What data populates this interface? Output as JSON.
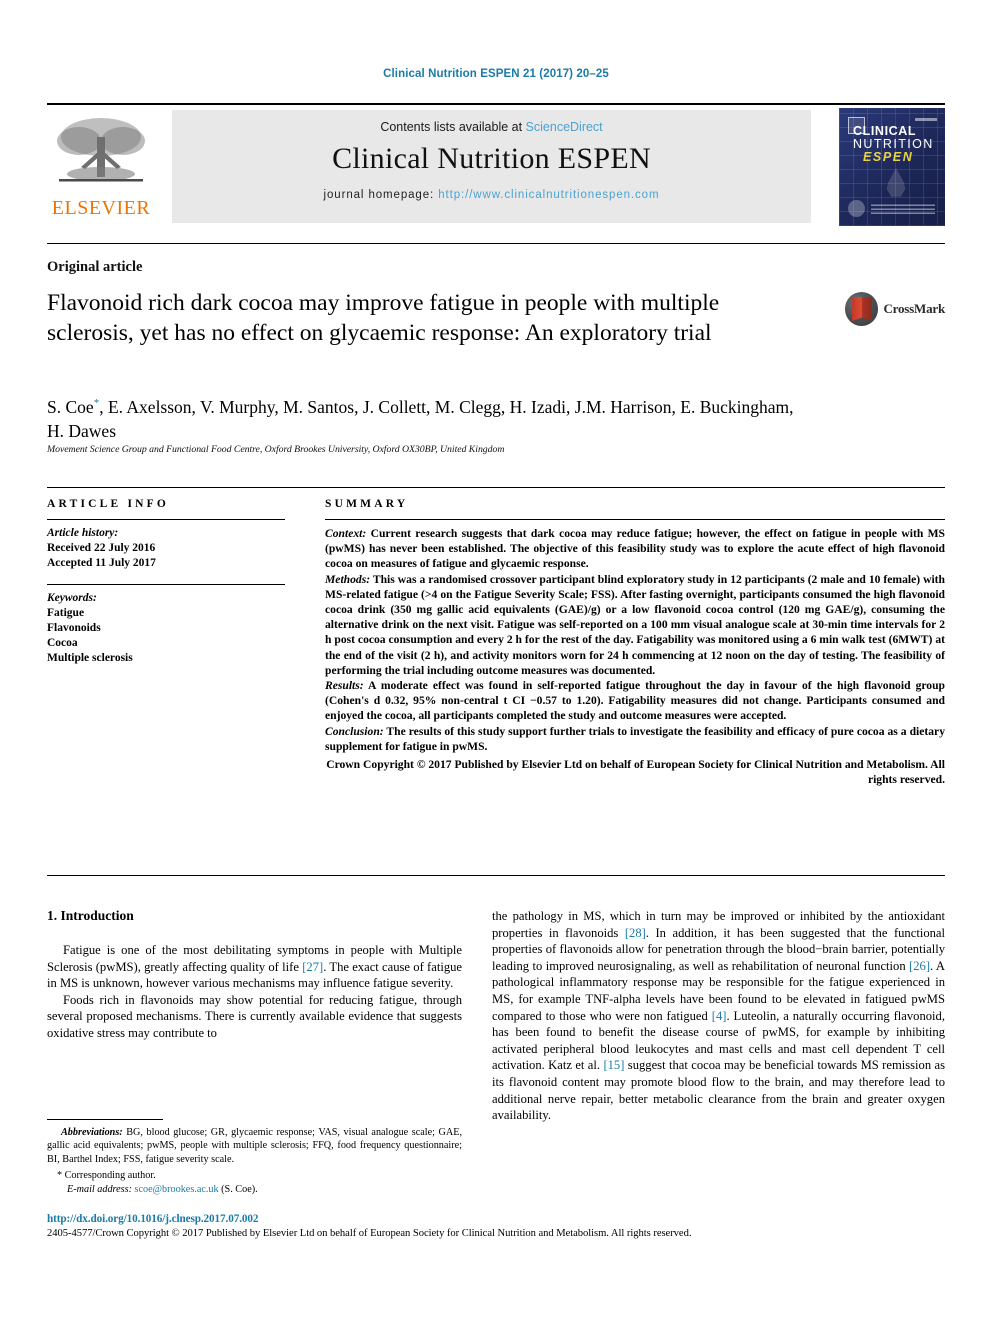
{
  "running_head": "Clinical Nutrition ESPEN 21 (2017) 20–25",
  "masthead": {
    "contents_prefix": "Contents lists available at ",
    "sciencedirect": "ScienceDirect",
    "journal_name": "Clinical Nutrition ESPEN",
    "homepage_label": "journal homepage:",
    "homepage_url": "http://www.clinicalnutritionespen.com",
    "publisher_logo_text": "ELSEVIER",
    "cover": {
      "line1": "CLINICAL",
      "line2": "NUTRITION",
      "line3": "ESPEN"
    },
    "accent_blue": "#4aa3d1",
    "elsevier_orange": "#ec7404"
  },
  "article": {
    "type": "Original article",
    "title": "Flavonoid rich dark cocoa may improve fatigue in people with multiple sclerosis, yet has no effect on glycaemic response: An exploratory trial",
    "authors": "S. Coe",
    "authors_rest": ", E. Axelsson, V. Murphy, M. Santos, J. Collett, M. Clegg, H. Izadi, J.M. Harrison, E. Buckingham, H. Dawes",
    "corresponding_marker": "*",
    "affiliation": "Movement Science Group and Functional Food Centre, Oxford Brookes University, Oxford OX30BP, United Kingdom",
    "crossmark_label": "CrossMark"
  },
  "article_info": {
    "heading": "ARTICLE INFO",
    "history_label": "Article history:",
    "history": [
      "Received 22 July 2016",
      "Accepted 11 July 2017"
    ],
    "keywords_label": "Keywords:",
    "keywords": [
      "Fatigue",
      "Flavonoids",
      "Cocoa",
      "Multiple sclerosis"
    ]
  },
  "summary": {
    "heading": "SUMMARY",
    "context_label": "Context:",
    "context": " Current research suggests that dark cocoa may reduce fatigue; however, the effect on fatigue in people with MS (pwMS) has never been established. The objective of this feasibility study was to explore the acute effect of high flavonoid cocoa on measures of fatigue and glycaemic response.",
    "methods_label": "Methods:",
    "methods": " This was a randomised crossover participant blind exploratory study in 12 participants (2 male and 10 female) with MS-related fatigue (>4 on the Fatigue Severity Scale; FSS). After fasting overnight, participants consumed the high flavonoid cocoa drink (350 mg gallic acid equivalents (GAE)/g) or a low flavonoid cocoa control (120 mg GAE/g), consuming the alternative drink on the next visit. Fatigue was self-reported on a 100 mm visual analogue scale at 30-min time intervals for 2 h post cocoa consumption and every 2 h for the rest of the day. Fatigability was monitored using a 6 min walk test (6MWT) at the end of the visit (2 h), and activity monitors worn for 24 h commencing at 12 noon on the day of testing. The feasibility of performing the trial including outcome measures was documented.",
    "results_label": "Results:",
    "results": " A moderate effect was found in self-reported fatigue throughout the day in favour of the high flavonoid group (Cohen's d 0.32, 95% non-central t CI −0.57 to 1.20). Fatigability measures did not change. Participants consumed and enjoyed the cocoa, all participants completed the study and outcome measures were accepted.",
    "conclusion_label": "Conclusion:",
    "conclusion": " The results of this study support further trials to investigate the feasibility and efficacy of pure cocoa as a dietary supplement for fatigue in pwMS.",
    "copyright": "Crown Copyright © 2017 Published by Elsevier Ltd on behalf of European Society for Clinical Nutrition and Metabolism. All rights reserved."
  },
  "body": {
    "section_heading": "1. Introduction",
    "left_paragraphs": [
      "Fatigue is one of the most debilitating symptoms in people with Multiple Sclerosis (pwMS), greatly affecting quality of life [27]. The exact cause of fatigue in MS is unknown, however various mechanisms may influence fatigue severity.",
      "Foods rich in flavonoids may show potential for reducing fatigue, through several proposed mechanisms. There is currently available evidence that suggests oxidative stress may contribute to"
    ],
    "right_paragraphs": [
      "the pathology in MS, which in turn may be improved or inhibited by the antioxidant properties in flavonoids [28]. In addition, it has been suggested that the functional properties of flavonoids allow for penetration through the blood−brain barrier, potentially leading to improved neurosignaling, as well as rehabilitation of neuronal function [26]. A pathological inflammatory response may be responsible for the fatigue experienced in MS, for example TNF-alpha levels have been found to be elevated in fatigued pwMS compared to those who were non fatigued [4]. Luteolin, a naturally occurring flavonoid, has been found to benefit the disease course of pwMS, for example by inhibiting activated peripheral blood leukocytes and mast cells and mast cell dependent T cell activation. Katz et al. [15] suggest that cocoa may be beneficial towards MS remission as its flavonoid content may promote blood flow to the brain, and may therefore lead to additional nerve repair, better metabolic clearance from the brain and greater oxygen availability."
    ],
    "reference_markers": [
      "[27]",
      "[28]",
      "[26]",
      "[4]",
      "[15]"
    ]
  },
  "footnotes": {
    "abbreviations_label": "Abbreviations:",
    "abbreviations": " BG, blood glucose; GR, glycaemic response; VAS, visual analogue scale; GAE, gallic acid equivalents; pwMS, people with multiple sclerosis; FFQ, food frequency questionnaire; BI, Barthel Index; FSS, fatigue severity scale.",
    "corresponding_marker": "*",
    "corresponding_text": "Corresponding author.",
    "email_label": "E-mail address:",
    "email": "scoe@brookes.ac.uk",
    "email_owner": "(S. Coe)."
  },
  "bottom": {
    "doi": "http://dx.doi.org/10.1016/j.clnesp.2017.07.002",
    "issn_copyright": "2405-4577/Crown Copyright © 2017 Published by Elsevier Ltd on behalf of European Society for Clinical Nutrition and Metabolism. All rights reserved."
  }
}
